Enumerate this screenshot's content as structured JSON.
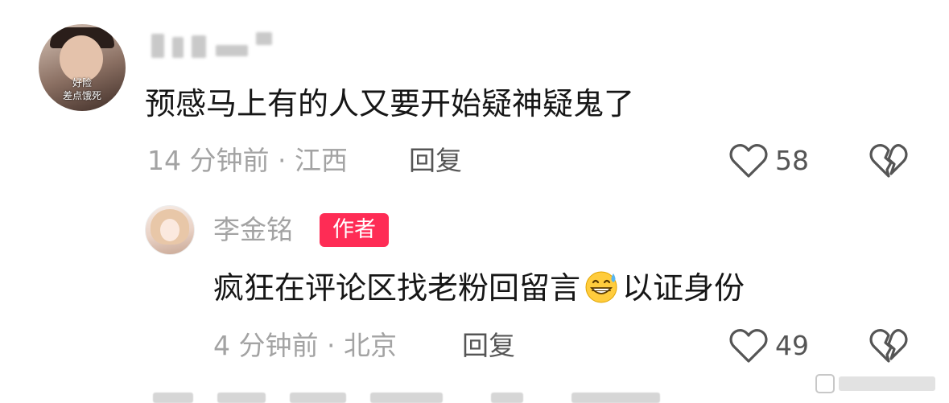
{
  "comments": [
    {
      "avatar_caption_1": "好险",
      "avatar_caption_2": "差点饿死",
      "text": "预感马上有的人又要开始疑神疑鬼了",
      "meta": "14 分钟前 · 江西",
      "reply_label": "回复",
      "likes": "58"
    },
    {
      "username": "李金铭",
      "badge": "作者",
      "text_before": "疯狂在评论区找老粉回留言",
      "emoji": "grinning-sweat-emoji",
      "text_after": "以证身份",
      "meta": "4 分钟前 · 北京",
      "reply_label": "回复",
      "likes": "49"
    }
  ],
  "icons": {
    "like": "heart-outline-icon",
    "dislike": "broken-heart-icon"
  },
  "colors": {
    "badge_bg": "#fe2c55",
    "meta_text": "#a3a3a3",
    "body_text": "#161616"
  }
}
